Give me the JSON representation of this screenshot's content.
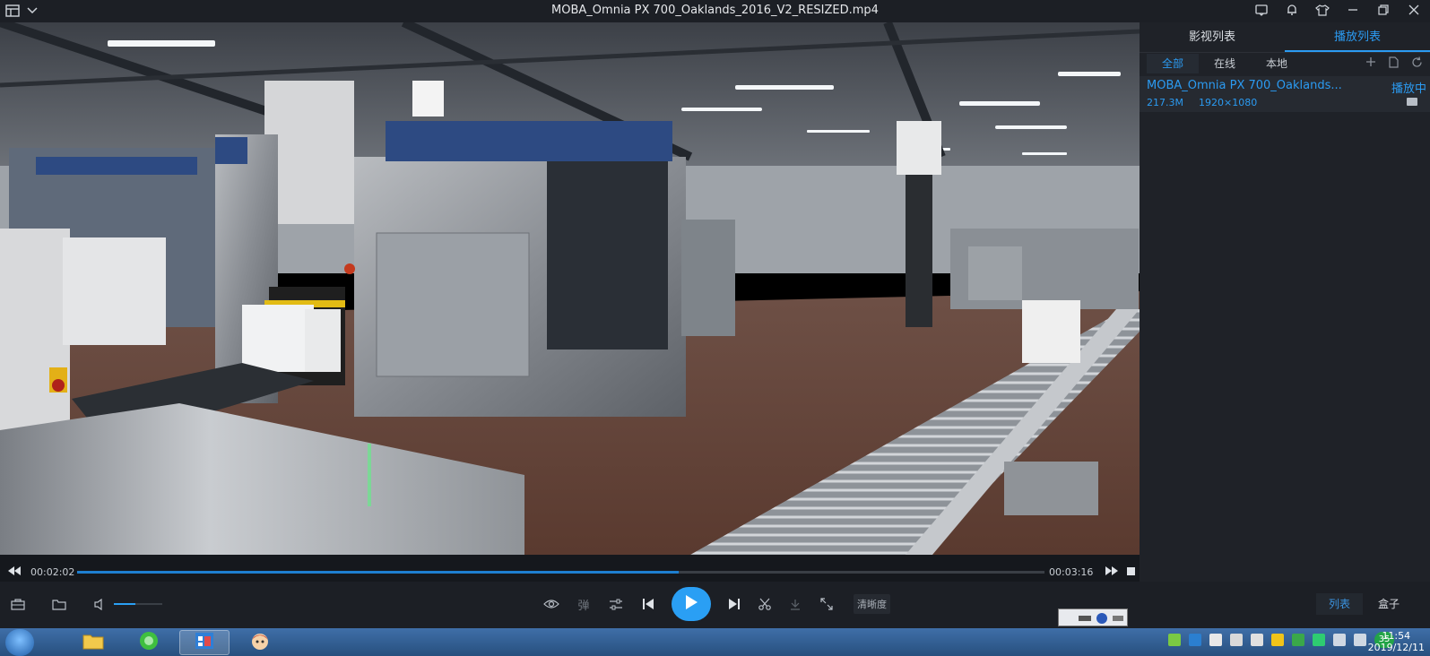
{
  "window": {
    "title": "MOBA_Omnia PX 700_Oaklands_2016_V2_RESIZED.mp4"
  },
  "player": {
    "current_time": "00:02:02",
    "total_time": "00:03:16",
    "progress": 0.622,
    "volume": 0.45,
    "quality_label": "清晰度"
  },
  "panel": {
    "tabs": [
      {
        "label": "影视列表",
        "active": false
      },
      {
        "label": "播放列表",
        "active": true
      }
    ],
    "subtabs": [
      {
        "label": "全部",
        "active": true
      },
      {
        "label": "在线",
        "active": false
      },
      {
        "label": "本地",
        "active": false
      }
    ],
    "playlist": [
      {
        "name": "MOBA_Omnia PX 700_Oaklands...",
        "status": "播放中",
        "size": "217.3M",
        "resolution": "1920×1080"
      }
    ]
  },
  "bottom_buttons": {
    "list": "列表",
    "box": "盒子"
  },
  "taskbar": {
    "time": "11:54",
    "date": "2019/12/11",
    "tray_badge": "35"
  },
  "colors": {
    "accent": "#2a9ff4",
    "panel_bg": "#1f2228",
    "titlebar_bg": "#1c1f25"
  },
  "icons": {
    "titlebar_left": [
      "menu-icon",
      "chevron-down-icon"
    ],
    "titlebar_right": [
      "chat-icon",
      "bell-icon",
      "shirt-icon",
      "minimize-icon",
      "restore-icon",
      "close-icon"
    ],
    "controls_left": [
      "toolbox-icon",
      "folder-open-icon",
      "volume-icon"
    ],
    "controls_center": [
      "eye-icon",
      "danmaku-icon",
      "settings-sliders-icon",
      "previous-icon",
      "play-icon",
      "next-icon",
      "scissors-icon",
      "download-icon",
      "fullscreen-icon"
    ]
  }
}
